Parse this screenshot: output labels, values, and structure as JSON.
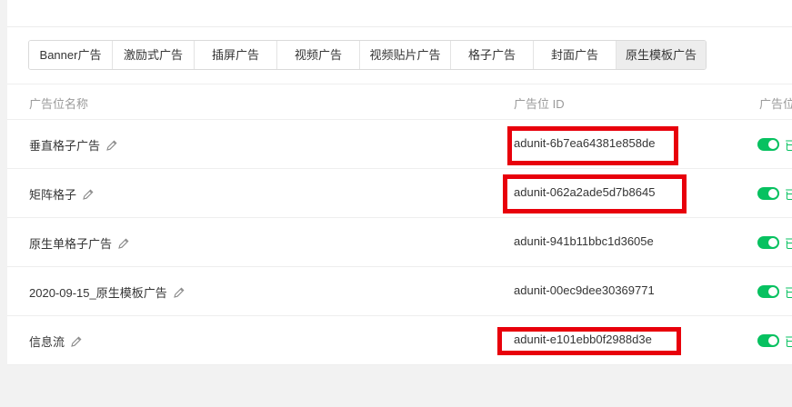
{
  "tabs": [
    {
      "label": "Banner广告"
    },
    {
      "label": "激励式广告"
    },
    {
      "label": "插屏广告"
    },
    {
      "label": "视频广告"
    },
    {
      "label": "视频贴片广告"
    },
    {
      "label": "格子广告"
    },
    {
      "label": "封面广告"
    },
    {
      "label": "原生模板广告",
      "active": true
    }
  ],
  "table": {
    "headers": {
      "name": "广告位名称",
      "id": "广告位 ID",
      "status": "广告位"
    },
    "rows": [
      {
        "name": "垂直格子广告",
        "unit_id": "adunit-6b7ea64381e858de",
        "status": "已",
        "enabled": true,
        "highlighted": true
      },
      {
        "name": "矩阵格子",
        "unit_id": "adunit-062a2ade5d7b8645",
        "status": "已",
        "enabled": true,
        "highlighted": true
      },
      {
        "name": "原生单格子广告",
        "unit_id": "adunit-941b11bbc1d3605e",
        "status": "已",
        "enabled": true,
        "highlighted": false
      },
      {
        "name": "2020-09-15_原生模板广告",
        "unit_id": "adunit-00ec9dee30369771",
        "status": "已",
        "enabled": true,
        "highlighted": false
      },
      {
        "name": "信息流",
        "unit_id": "adunit-e101ebb0f2988d3e",
        "status": "已",
        "enabled": true,
        "highlighted": true
      }
    ]
  },
  "colors": {
    "toggle_on": "#07c160",
    "highlight": "#e8000b",
    "text": "#353535",
    "muted": "#9a9a9a"
  },
  "icons": {
    "edit": "pencil-icon"
  }
}
